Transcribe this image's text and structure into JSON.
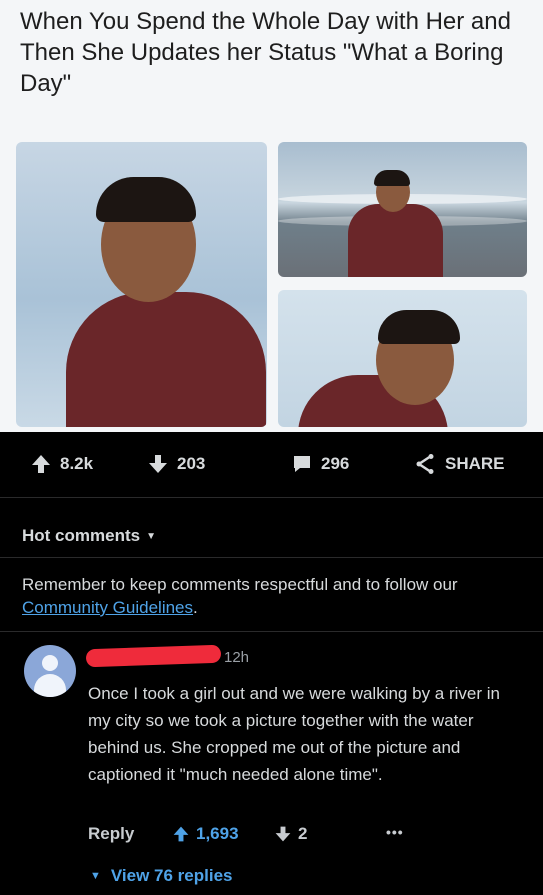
{
  "meme": {
    "caption": "When You Spend the Whole Day with Her and Then She Updates her Status \"What a Boring Day\""
  },
  "post_actions": {
    "upvotes": "8.2k",
    "downvotes": "203",
    "comments": "296",
    "share_label": "SHARE"
  },
  "comments_header": {
    "sort_label": "Hot comments"
  },
  "notice": {
    "text": "Remember to keep comments respectful and to follow our ",
    "link_text": "Community Guidelines",
    "suffix": "."
  },
  "comment": {
    "time": "12h",
    "body": "Once I took a girl out and we were walking by a river in my city so we took a picture together with the water behind us. She cropped me out of the picture and captioned it \"much needed alone time\".",
    "reply_label": "Reply",
    "upvotes": "1,693",
    "downvotes": "2",
    "more": "•••",
    "view_replies": "View 76 replies"
  },
  "colors": {
    "background": "#000000",
    "accent_blue": "#4fa3e8",
    "redaction": "#ef2b3b",
    "text": "#d7dadc"
  }
}
